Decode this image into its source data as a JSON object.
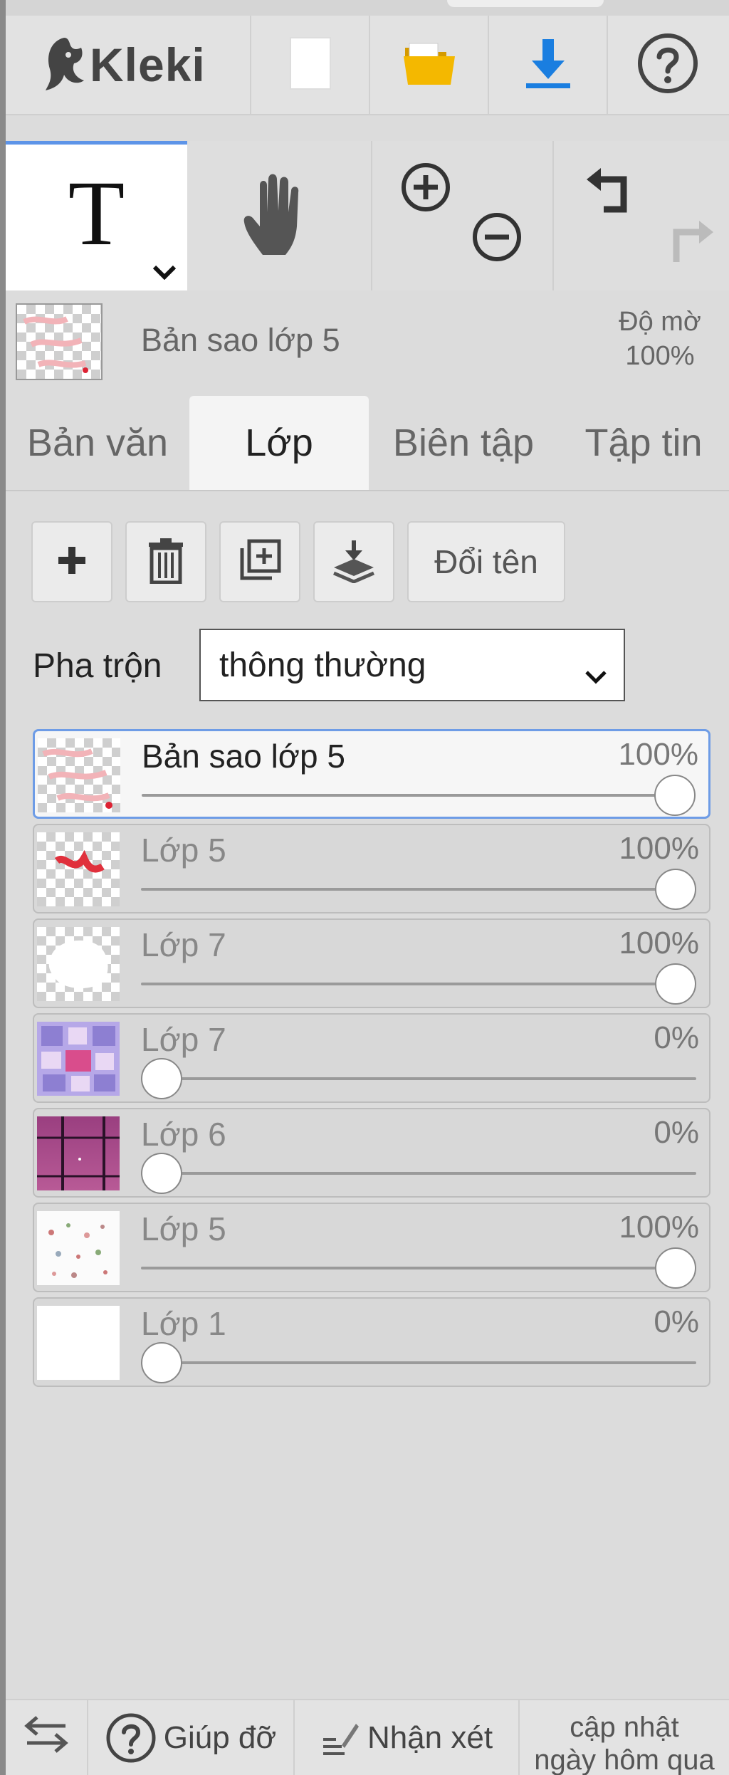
{
  "app": {
    "name": "Kleki"
  },
  "header": {
    "buttons": [
      {
        "name": "new-image",
        "icon": "new-page-icon"
      },
      {
        "name": "open-image",
        "icon": "folder-icon"
      },
      {
        "name": "save-image",
        "icon": "download-icon"
      },
      {
        "name": "help",
        "icon": "help-icon"
      }
    ]
  },
  "tools": {
    "text": {
      "label": "T",
      "icon": "text-tool-icon"
    },
    "hand": {
      "icon": "hand-icon"
    },
    "zoom": {
      "icons": [
        "zoom-in-icon",
        "zoom-out-icon"
      ]
    },
    "history": {
      "icons": [
        "undo-icon",
        "redo-icon"
      ]
    }
  },
  "current_layer": {
    "name": "Bản sao lớp 5",
    "opacity_label": "Độ mờ",
    "opacity_value": "100%"
  },
  "tabs": [
    {
      "label": "Bản văn",
      "active": false
    },
    {
      "label": "Lớp",
      "active": true
    },
    {
      "label": "Biên tập",
      "active": false
    },
    {
      "label": "Tập tin",
      "active": false
    }
  ],
  "layer_actions": {
    "icons": [
      "plus-icon",
      "trash-icon",
      "duplicate-icon",
      "merge-down-icon"
    ],
    "rename_label": "Đổi tên"
  },
  "blend": {
    "label": "Pha trộn",
    "value": "thông thường"
  },
  "layers": [
    {
      "name": "Bản sao lớp 5",
      "opacity_label": "100%",
      "opacity": 1.0,
      "selected": true
    },
    {
      "name": "Lớp 5",
      "opacity_label": "100%",
      "opacity": 1.0,
      "selected": false
    },
    {
      "name": "Lớp 7",
      "opacity_label": "100%",
      "opacity": 1.0,
      "selected": false
    },
    {
      "name": "Lớp 7",
      "opacity_label": "0%",
      "opacity": 0.0,
      "selected": false
    },
    {
      "name": "Lớp 6",
      "opacity_label": "0%",
      "opacity": 0.0,
      "selected": false
    },
    {
      "name": "Lớp 5",
      "opacity_label": "100%",
      "opacity": 1.0,
      "selected": false
    },
    {
      "name": "Lớp 1",
      "opacity_label": "0%",
      "opacity": 0.0,
      "selected": false
    }
  ],
  "footer": {
    "swap_icon": "swap-icon",
    "help_label": "Giúp đỡ",
    "feedback_label": "Nhận xét",
    "update_line1": "cập nhật",
    "update_line2": "ngày hôm qua"
  },
  "colors": {
    "accent": "#5d94e8",
    "download": "#1a7ee0",
    "folder": "#f0b400",
    "background": "#dcdcdc"
  }
}
